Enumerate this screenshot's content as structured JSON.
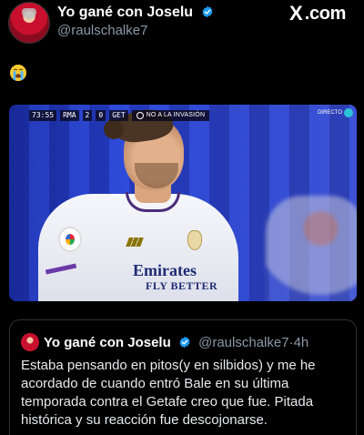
{
  "post": {
    "author_name": "Yo gané con Joselu",
    "author_handle": "@raulschalke7",
    "body_emoji": "😭",
    "verified": true
  },
  "brand": {
    "logo_text": ".com",
    "logo_glyph": "X"
  },
  "media": {
    "scorebug": {
      "clock": "73:55",
      "home_team": "RMA",
      "home_score": "2",
      "away_score": "0",
      "away_team": "GET",
      "var_notice": "NO A LA INVASIÓN"
    },
    "live_label": "DIRECTO",
    "shirt_sponsor": "Emirates",
    "shirt_sponsor_line2": "FLY BETTER"
  },
  "quoted_post": {
    "author_name": "Yo gané con Joselu",
    "author_handle": "@raulschalke7",
    "separator": "·",
    "time": "4h",
    "text": "Estaba pensando en pitos(y en silbidos) y me he acordado de cuando entró Bale en su última temporada contra el Getafe creo que fue. Pitada histórica y su reacción fue descojonarse."
  },
  "colors": {
    "background": "#000000",
    "verified_badge": "#1d9bf0",
    "muted_text": "#8b98a5",
    "card_border": "#2f3336"
  }
}
